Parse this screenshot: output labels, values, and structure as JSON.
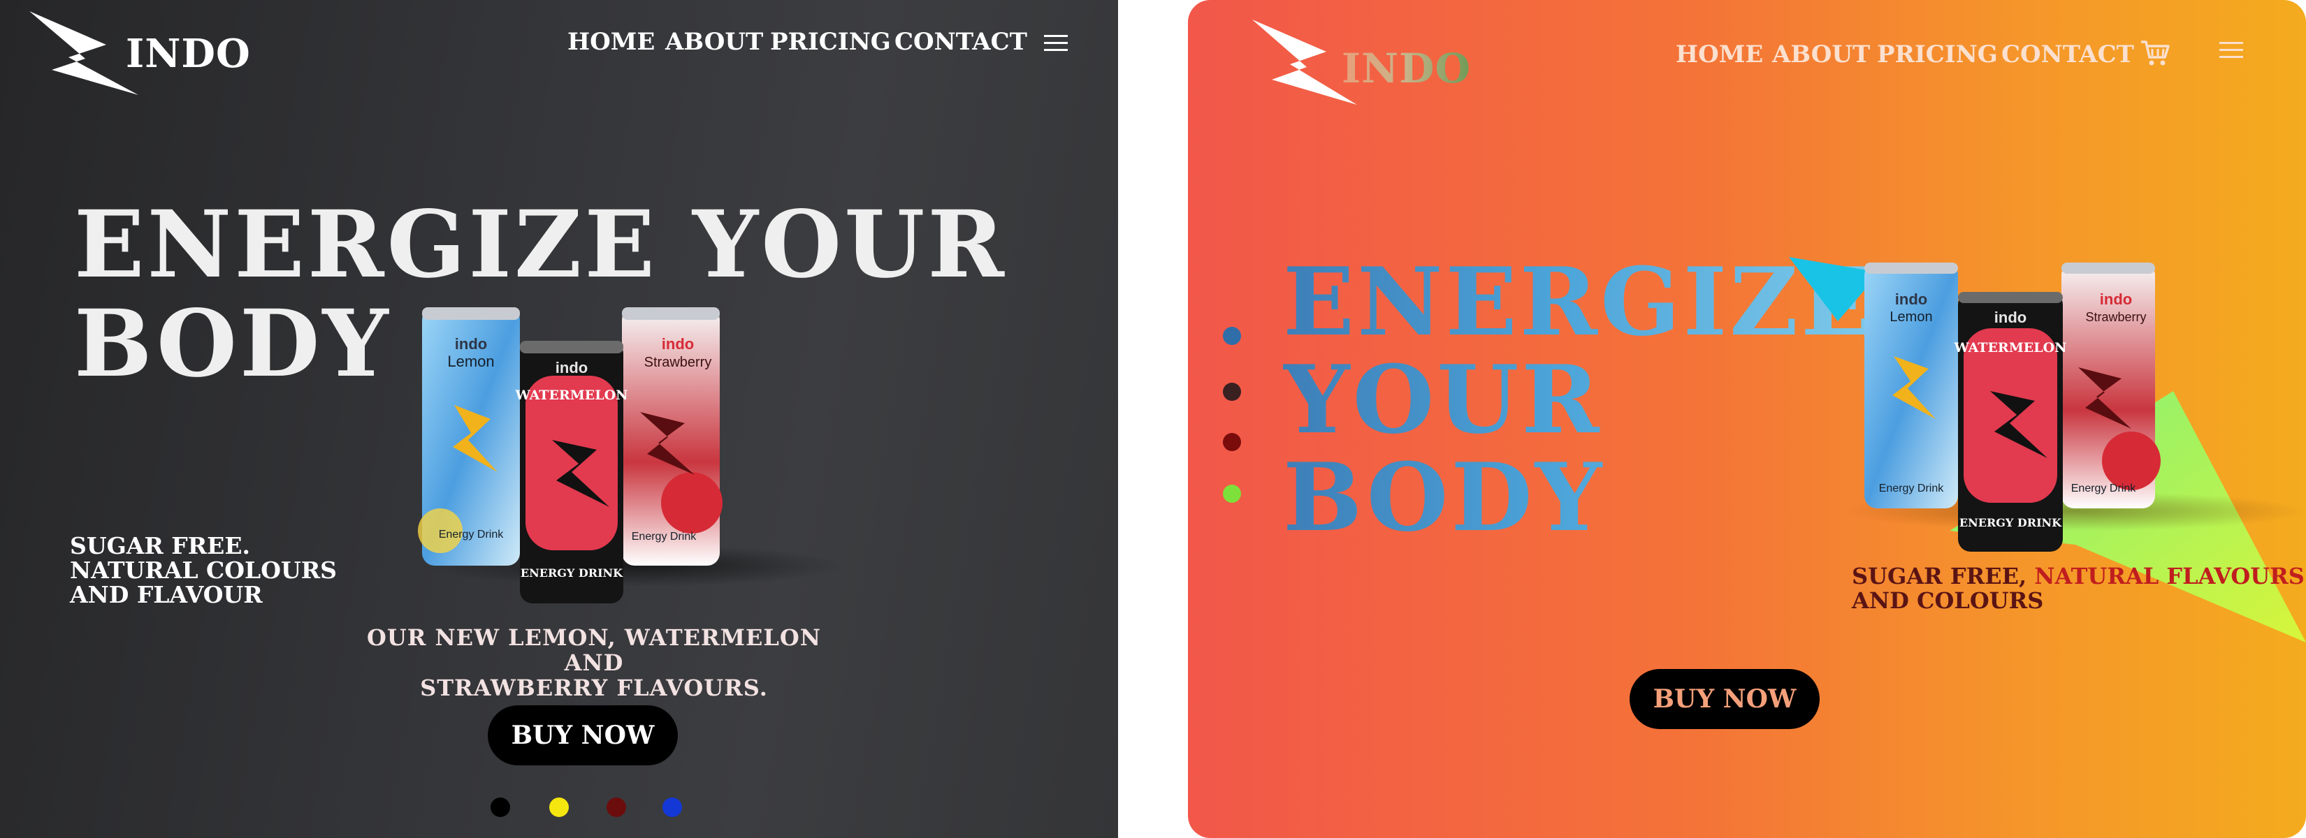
{
  "left": {
    "brand": "INDO",
    "nav": [
      "HOME",
      "ABOUT",
      "PRICING",
      "CONTACT"
    ],
    "menu_icon": "hamburger-menu-icon",
    "hero_line1": "ENERGIZE YOUR",
    "hero_line2": "BODY",
    "side_text": [
      "SUGAR FREE.",
      "NATURAL COLOURS",
      "AND FLAVOUR"
    ],
    "sub_text": [
      "OUR NEW LEMON, WATERMELON AND",
      "STRAWBERRY FLAVOURS."
    ],
    "buy_label": "BUY NOW",
    "cans": [
      {
        "logo": "indo",
        "flavor": "Lemon",
        "bottom": "Energy Drink"
      },
      {
        "logo": "indo",
        "flavor": "WATERMELON",
        "bottom": "ENERGY DRINK"
      },
      {
        "logo": "indo",
        "flavor": "Strawberry",
        "bottom": "Energy Drink"
      }
    ],
    "dot_colors": [
      "#000000",
      "#f5e60f",
      "#6b0d0d",
      "#1438d6"
    ],
    "colors": {
      "background": "#343537",
      "text": "#ffffff",
      "button": "#000000"
    }
  },
  "right": {
    "brand": "INDO",
    "nav": [
      "HOME",
      "ABOUT",
      "PRICING",
      "CONTACT"
    ],
    "cart_icon": "shopping-cart-icon",
    "menu_icon": "hamburger-menu-icon",
    "hero_lines": [
      "ENERGIZE",
      "YOUR",
      "BODY"
    ],
    "side_text_a": "SUGAR FREE, ",
    "side_text_b": "NATURAL FLAVOURS",
    "side_text_c": "AND COLOURS",
    "buy_label": "BUY NOW",
    "cans": [
      {
        "logo": "indo",
        "flavor": "Lemon",
        "bottom": "Energy Drink"
      },
      {
        "logo": "indo",
        "flavor": "WATERMELON",
        "bottom": "ENERGY DRINK"
      },
      {
        "logo": "indo",
        "flavor": "Strawberry",
        "bottom": "Energy Drink"
      }
    ],
    "dot_colors": [
      "#2f6ea8",
      "#3a2020",
      "#7a0c0c",
      "#7ee03a"
    ],
    "colors": {
      "gradient_start": "#f2574a",
      "gradient_end": "#f4ab1e",
      "hero": "#4ba3d8",
      "button": "#000000",
      "button_text": "#f5a07a"
    }
  }
}
